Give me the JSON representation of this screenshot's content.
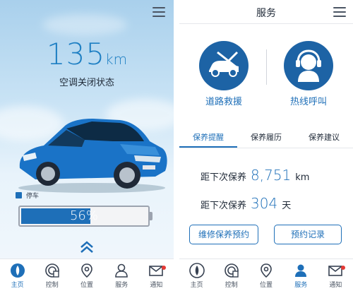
{
  "left": {
    "range_value": "135",
    "range_unit": "km",
    "ac_status": "空调关闭状态",
    "park_label": "停车",
    "battery_percent": 56,
    "battery_text": "56%"
  },
  "right": {
    "title": "服务",
    "services": [
      {
        "label": "道路救援",
        "icon": "roadside-rescue-icon"
      },
      {
        "label": "热线呼叫",
        "icon": "hotline-headset-icon"
      }
    ],
    "tabs": [
      "保养提醒",
      "保养履历",
      "保养建议"
    ],
    "active_tab": 0,
    "distance_label": "距下次保养",
    "distance_value": "8,751",
    "distance_unit": "km",
    "days_label": "距下次保养",
    "days_value": "304",
    "days_unit": "天",
    "btn_booking": "维修保养预约",
    "btn_records": "预约记录"
  },
  "nav_left": [
    {
      "label": "主页",
      "icon": "home-car-icon"
    },
    {
      "label": "控制",
      "icon": "control-icon"
    },
    {
      "label": "位置",
      "icon": "location-pin-icon"
    },
    {
      "label": "服务",
      "icon": "service-person-icon"
    },
    {
      "label": "通知",
      "icon": "mail-icon"
    }
  ],
  "nav_right": [
    {
      "label": "主页",
      "icon": "home-car-icon"
    },
    {
      "label": "控制",
      "icon": "control-icon"
    },
    {
      "label": "位置",
      "icon": "location-pin-icon"
    },
    {
      "label": "服务",
      "icon": "service-person-icon"
    },
    {
      "label": "通知",
      "icon": "mail-icon"
    }
  ],
  "colors": {
    "accent": "#1e6fb8",
    "notification": "#e53935"
  }
}
